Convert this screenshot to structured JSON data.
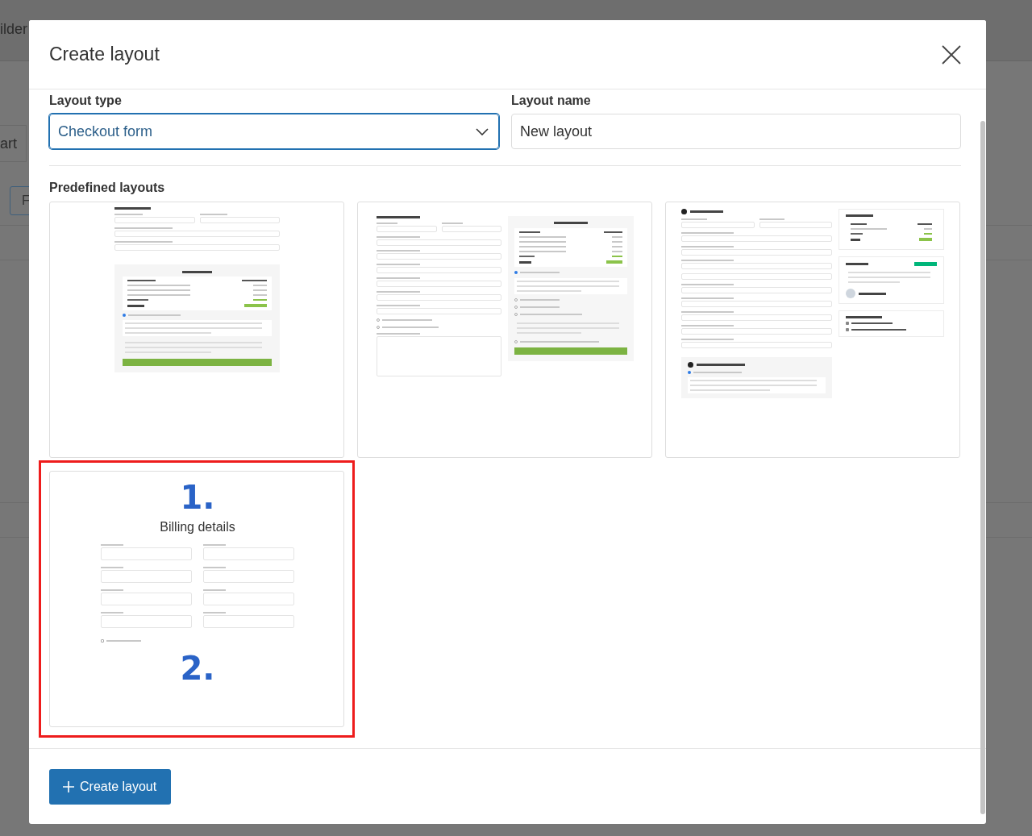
{
  "background": {
    "heading": "ilder",
    "tab": "art",
    "field": "F"
  },
  "dialog": {
    "title": "Create layout",
    "fields": [
      {
        "label": "Layout type",
        "value": "Checkout form",
        "kind": "select",
        "focused": true
      },
      {
        "label": "Layout name",
        "value": "New layout",
        "kind": "text",
        "focused": false
      }
    ],
    "section_title": "Predefined layouts",
    "layouts": [
      {
        "kind": "stacked",
        "selected": false
      },
      {
        "kind": "split",
        "selected": false
      },
      {
        "kind": "steps",
        "selected": false
      },
      {
        "kind": "numbered",
        "selected": true,
        "first_number": "1.",
        "title": "Billing details",
        "second_number": "2."
      }
    ],
    "create_button": "Create layout"
  }
}
